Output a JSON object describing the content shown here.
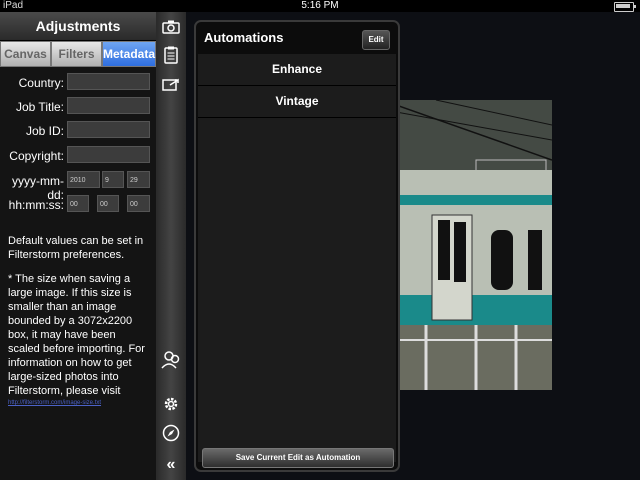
{
  "status_bar": {
    "carrier": "iPad",
    "time": "5:16 PM"
  },
  "adjustments": {
    "title": "Adjustments",
    "tabs": [
      {
        "label": "Canvas",
        "active": false
      },
      {
        "label": "Filters",
        "active": false
      },
      {
        "label": "Metadata",
        "active": true
      }
    ],
    "fields": {
      "country": {
        "label": "Country:",
        "value": ""
      },
      "job_title": {
        "label": "Job Title:",
        "value": ""
      },
      "job_id": {
        "label": "Job ID:",
        "value": ""
      },
      "copyright": {
        "label": "Copyright:",
        "value": ""
      },
      "date": {
        "label": "yyyy-mm-dd:",
        "year": "2010",
        "month": "9",
        "day": "29"
      },
      "time": {
        "label": "hh:mm:ss:",
        "hh": "00",
        "mm": "00",
        "ss": "00"
      }
    },
    "note1": "Default values can be set in Filterstorm preferences.",
    "note2": "* The size when saving a large image. If this size is smaller than an image bounded by a 3072x2200 box, it may have been scaled before importing. For information on how to get large-sized photos into Filterstorm, please visit",
    "link": "http://filterstorm.com/image-size.txt"
  },
  "toolbar": {
    "icons": [
      "camera-icon",
      "clipboard-icon",
      "export-icon",
      "people-icon",
      "gear-icon",
      "compass-icon",
      "collapse-icon"
    ],
    "collapse_glyph": "«"
  },
  "automations": {
    "title": "Automations",
    "edit_label": "Edit",
    "items": [
      "Enhance",
      "Vintage"
    ],
    "save_label": "Save Current Edit as Automation"
  },
  "colors": {
    "accent": "#2e6ee0",
    "panel": "#141414",
    "popover": "#1c1c1c"
  }
}
